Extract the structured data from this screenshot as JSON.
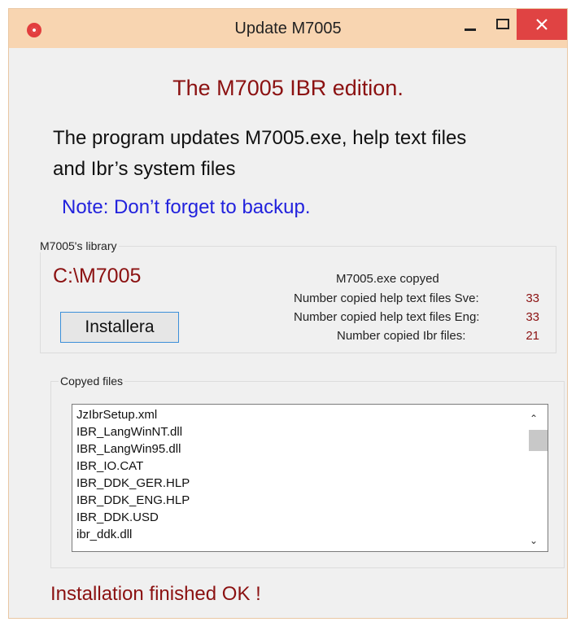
{
  "window": {
    "title": "Update M7005"
  },
  "heading": "The M7005 IBR edition.",
  "description_line1": "The program updates M7005.exe, help text files",
  "description_line2": "and Ibr’s system files",
  "note": "Note: Don’t forget to backup.",
  "library": {
    "group_label": "M7005's library",
    "path": "C:\\M7005",
    "install_label": "Installera",
    "status": {
      "exe_copied": "M7005.exe copyed",
      "help_sve_label": "Number copied help text files Sve:",
      "help_sve_value": "33",
      "help_eng_label": "Number copied help text files Eng:",
      "help_eng_value": "33",
      "ibr_label": "Number copied Ibr files:",
      "ibr_value": "21"
    }
  },
  "copied": {
    "group_label": "Copyed files",
    "files": [
      "JzIbrSetup.xml",
      "IBR_LangWinNT.dll",
      "IBR_LangWin95.dll",
      "IBR_IO.CAT",
      "IBR_DDK_GER.HLP",
      "IBR_DDK_ENG.HLP",
      "IBR_DDK.USD",
      "ibr_ddk.dll"
    ]
  },
  "finished": "Installation finished OK !",
  "colors": {
    "titlebar": "#f8d5b1",
    "close": "#e04343",
    "heading": "#8b1111",
    "note": "#2222dd"
  },
  "icons": [
    "app-icon",
    "minimize-icon",
    "maximize-icon",
    "close-icon",
    "scroll-up-icon",
    "scroll-down-icon"
  ]
}
